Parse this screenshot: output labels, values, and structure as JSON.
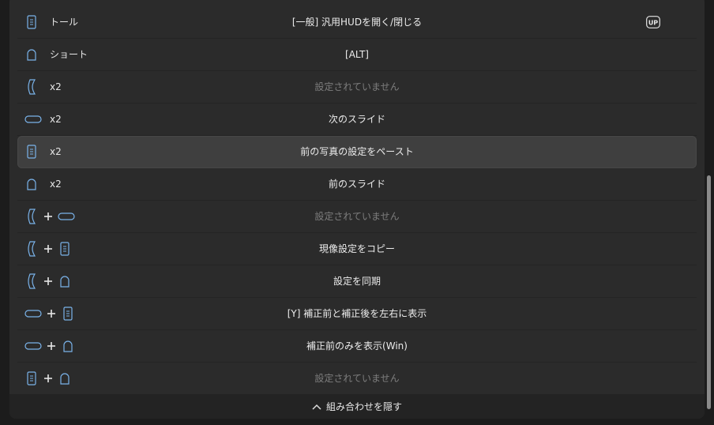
{
  "rows": [
    {
      "keys": [
        "doc"
      ],
      "modifier": "トール",
      "action": "[一般] 汎用HUDを開く/閉じる",
      "dim": false,
      "badge": "UP"
    },
    {
      "keys": [
        "dome"
      ],
      "modifier": "ショート",
      "action": "[ALT]",
      "dim": false
    },
    {
      "keys": [
        "curve"
      ],
      "modifier": "x2",
      "action": "設定されていません",
      "dim": true
    },
    {
      "keys": [
        "pill"
      ],
      "modifier": "x2",
      "action": "次のスライド",
      "dim": false
    },
    {
      "keys": [
        "doc"
      ],
      "modifier": "x2",
      "action": "前の写真の設定をペースト",
      "dim": false,
      "highlight": true
    },
    {
      "keys": [
        "dome"
      ],
      "modifier": "x2",
      "action": "前のスライド",
      "dim": false
    },
    {
      "keys": [
        "curve",
        "pill"
      ],
      "modifier": "",
      "action": "設定されていません",
      "dim": true
    },
    {
      "keys": [
        "curve",
        "doc"
      ],
      "modifier": "",
      "action": "現像設定をコピー",
      "dim": false
    },
    {
      "keys": [
        "curve",
        "dome"
      ],
      "modifier": "",
      "action": "設定を同期",
      "dim": false
    },
    {
      "keys": [
        "pill",
        "doc"
      ],
      "modifier": "",
      "action": "[Y] 補正前と補正後を左右に表示",
      "dim": false
    },
    {
      "keys": [
        "pill",
        "dome"
      ],
      "modifier": "",
      "action": "補正前のみを表示(Win)",
      "dim": false
    },
    {
      "keys": [
        "doc",
        "dome"
      ],
      "modifier": "",
      "action": "設定されていません",
      "dim": true
    }
  ],
  "footer": {
    "label": "組み合わせを隠す",
    "icon": "chevron-up-icon"
  },
  "colors": {
    "icon": "#7ab3ea",
    "panel": "#2b2b2b",
    "highlight": "#3f3f3f",
    "dim_text": "#7d7d7d"
  }
}
